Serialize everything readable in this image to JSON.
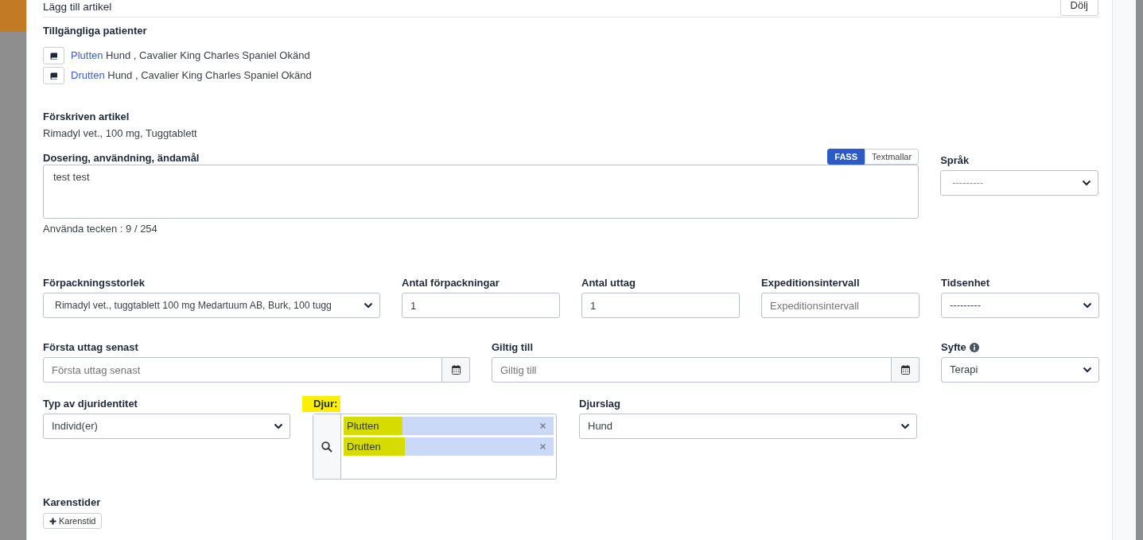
{
  "header": {
    "title": "Lägg till artikel",
    "hide_button": "Dölj"
  },
  "patients": {
    "heading": "Tillgängliga patienter",
    "items": [
      {
        "name": "Plutten",
        "details": "Hund , Cavalier King Charles Spaniel Okänd"
      },
      {
        "name": "Drutten",
        "details": "Hund , Cavalier King Charles Spaniel Okänd"
      }
    ]
  },
  "prescribed": {
    "heading": "Förskriven artikel",
    "value": "Rimadyl vet., 100 mg, Tuggtablett"
  },
  "dosage": {
    "label": "Dosering, användning, ändamål",
    "toggle": [
      {
        "label": "FASS",
        "selected": true
      },
      {
        "label": "Textmallar",
        "selected": false
      }
    ],
    "value": "test test",
    "counter": "Använda tecken : 9 / 254"
  },
  "language": {
    "label": "Språk",
    "value": "---------"
  },
  "field_rows": [
    {
      "fields": [
        {
          "kind": "select",
          "label": "Förpackningsstorlek",
          "value": "Rimadyl vet., tuggtablett 100 mg Medartuum AB, Burk, 100 tugg"
        },
        {
          "kind": "input",
          "label": "Antal förpackningar",
          "value": "1"
        },
        {
          "kind": "input",
          "label": "Antal uttag",
          "value": "1"
        },
        {
          "kind": "input",
          "label": "Expeditionsintervall",
          "placeholder": "Expeditionsintervall"
        },
        {
          "kind": "select",
          "label": "Tidsenhet",
          "value": "---------"
        }
      ]
    },
    {
      "fields": [
        {
          "kind": "date",
          "label": "Första uttag senast",
          "placeholder": "Första uttag senast"
        },
        {
          "kind": "date",
          "label": "Giltig till",
          "placeholder": "Giltig till"
        },
        {
          "kind": "select",
          "label": "Syfte",
          "info": true,
          "value": "Terapi"
        }
      ]
    },
    {
      "fields": [
        {
          "kind": "select",
          "label": "Typ av djuridentitet",
          "value": "Individ(er)"
        },
        {
          "kind": "tags",
          "label": "Djur:",
          "highlighted": true,
          "tags": [
            {
              "text": "Plutten",
              "highlighted": true
            },
            {
              "text": "Drutten",
              "highlighted": true
            }
          ]
        },
        {
          "kind": "select",
          "label": "Djurslag",
          "value": "Hund"
        }
      ]
    }
  ],
  "withdrawal": {
    "heading": "Karenstider",
    "button": "Karenstid"
  }
}
